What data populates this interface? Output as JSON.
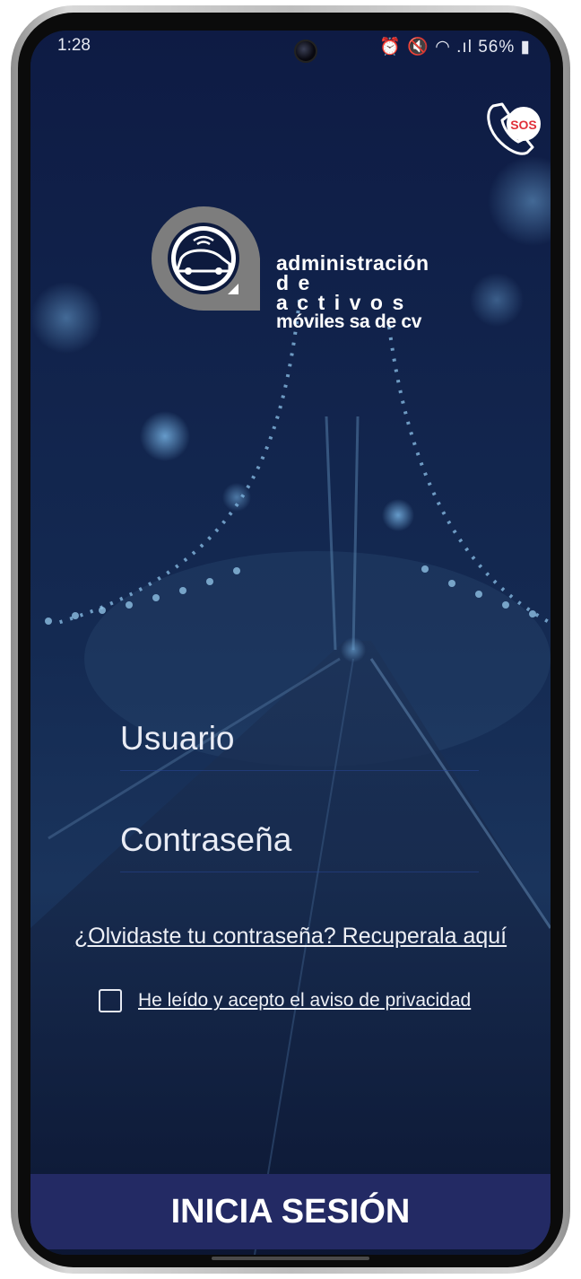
{
  "status_bar": {
    "time": "1:28",
    "icons": "⏰ 🔇 ◠ .ıl",
    "battery": "56%"
  },
  "logo": {
    "line1": "administración",
    "line2": "de activos",
    "line3": "móviles sa de cv",
    "icon": "car-emblem-icon"
  },
  "sos": {
    "label": "SOS",
    "icon": "phone-sos-icon"
  },
  "form": {
    "user_placeholder": "Usuario",
    "user_value": "",
    "pass_placeholder": "Contraseña",
    "pass_value": ""
  },
  "forgot_link": "¿Olvidaste tu contraseña? Recuperala aquí",
  "privacy": {
    "label": "He leído y acepto el aviso de privacidad",
    "checked": false
  },
  "login_button": "INICIA SESIÓN",
  "colors": {
    "background": "#0d1a3e",
    "button": "#232a64",
    "sos": "#e0303a",
    "logo_gray": "#7d7d7d"
  }
}
